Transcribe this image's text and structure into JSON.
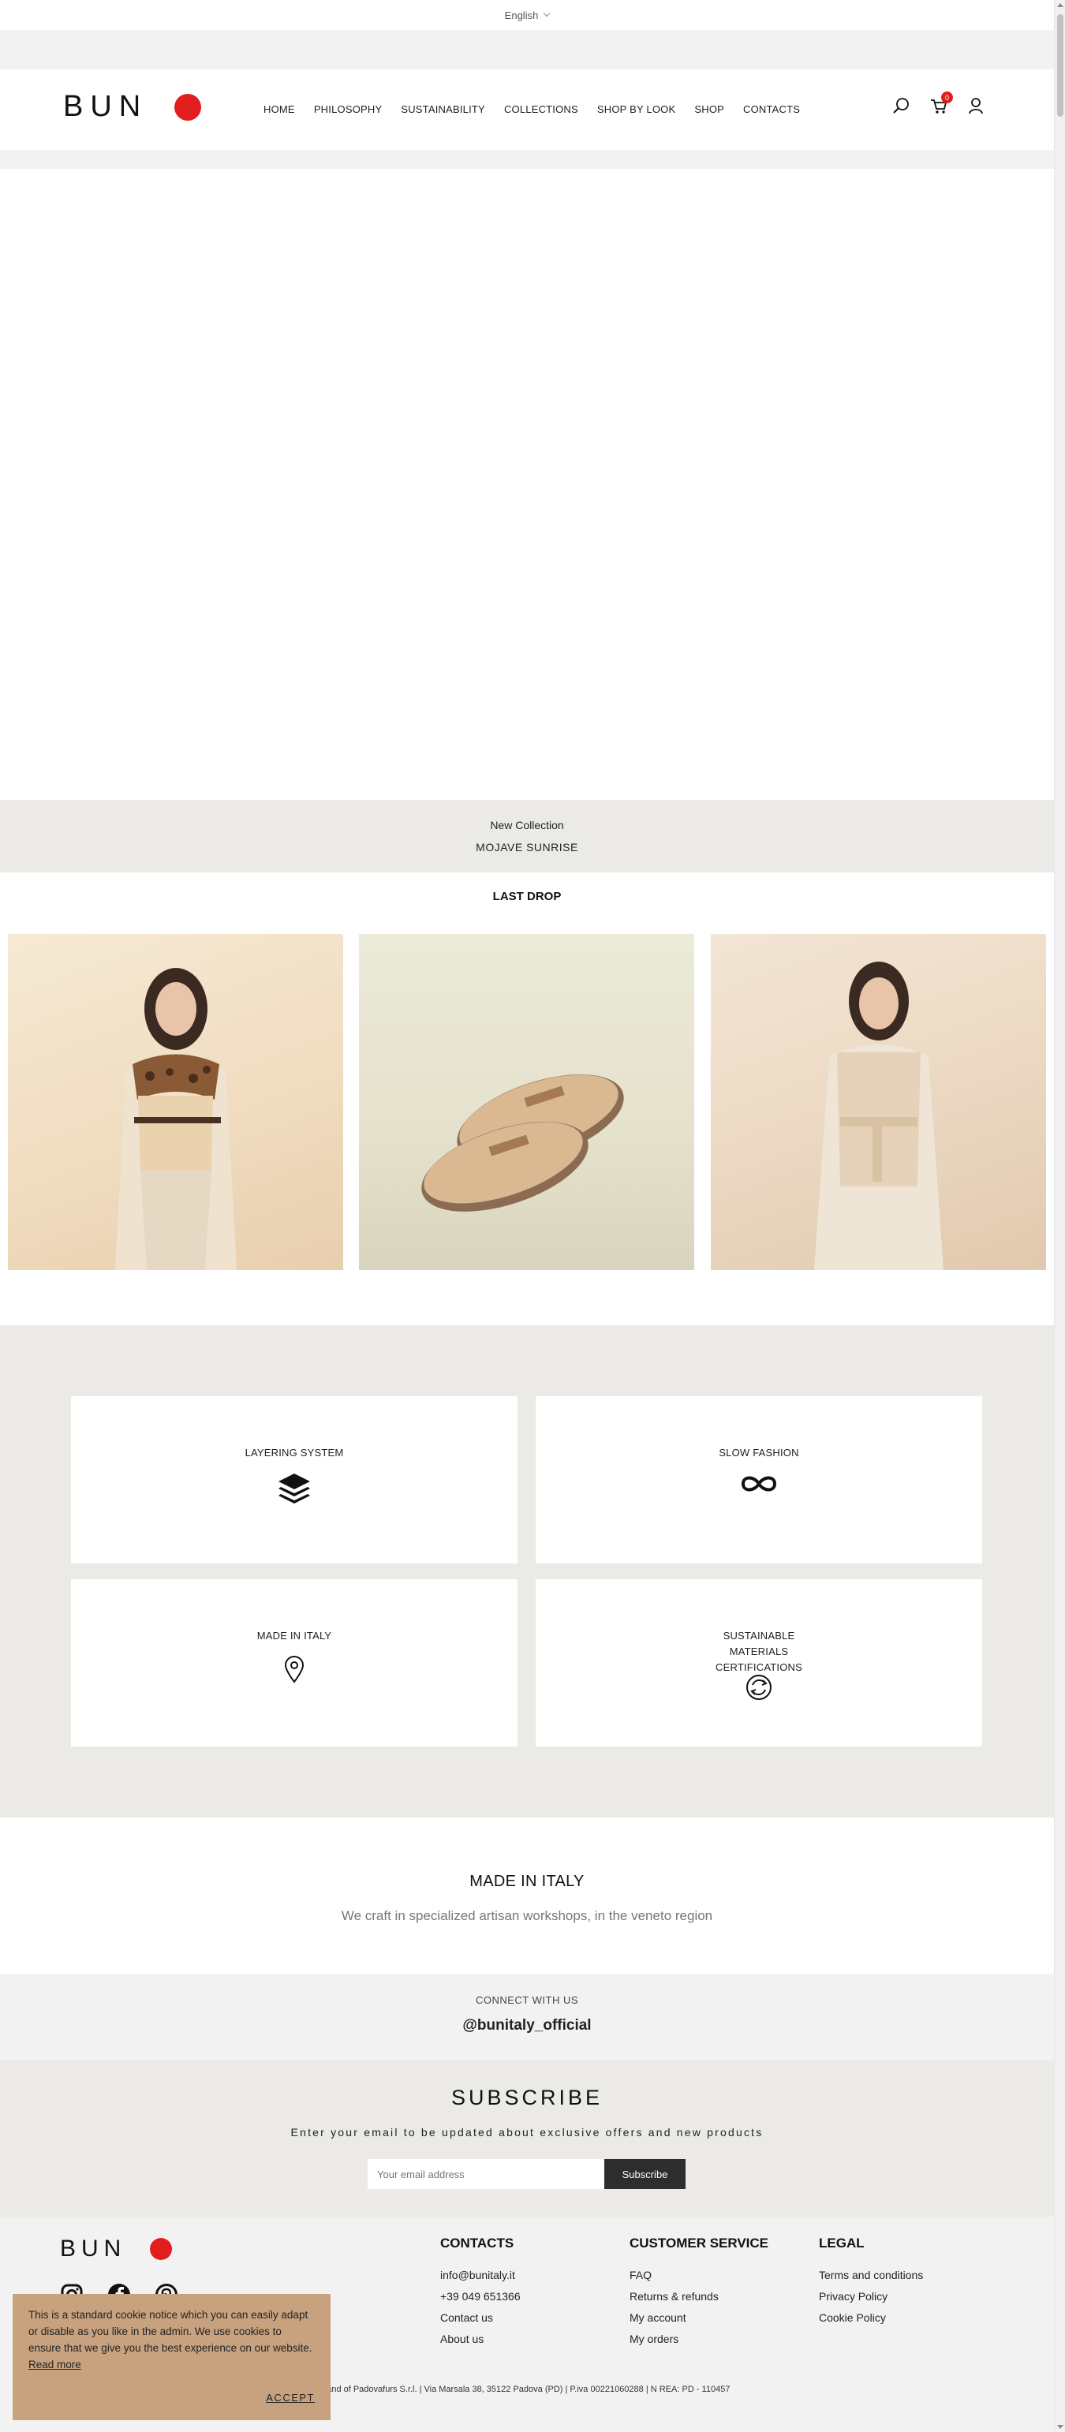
{
  "language": {
    "selected": "English"
  },
  "header": {
    "logo_text": "BUN",
    "nav": [
      "HOME",
      "PHILOSOPHY",
      "SUSTAINABILITY",
      "COLLECTIONS",
      "SHOP BY LOOK",
      "SHOP",
      "CONTACTS"
    ],
    "cart_count": "0"
  },
  "collection": {
    "subtitle": "New Collection",
    "name": "MOJAVE SUNRISE"
  },
  "last_drop": {
    "title": "LAST DROP"
  },
  "features": [
    {
      "title": "LAYERING SYSTEM",
      "icon": "layers-icon"
    },
    {
      "title": "SLOW FASHION",
      "icon": "infinity-icon"
    },
    {
      "title": "MADE IN ITALY",
      "icon": "map-pin-icon"
    },
    {
      "title": "SUSTAINABLE MATERIALS CERTIFICATIONS",
      "icon": "recycle-icon"
    }
  ],
  "made_in_italy": {
    "title": "MADE IN ITALY",
    "text": "We craft in specialized artisan workshops, in the veneto region"
  },
  "connect": {
    "label": "CONNECT WITH US",
    "handle": "@bunitaly_official"
  },
  "subscribe": {
    "title": "SUBSCRIBE",
    "description": "Enter your email to be updated about exclusive offers and new products",
    "placeholder": "Your email address",
    "button": "Subscribe"
  },
  "footer": {
    "logo_text": "BUN",
    "contacts": {
      "title": "CONTACTS",
      "links": [
        "info@bunitaly.it",
        "+39 049 651366",
        "Contact us",
        "About us"
      ]
    },
    "customer_service": {
      "title": "CUSTOMER SERVICE",
      "links": [
        "FAQ",
        "Returns & refunds",
        "My account",
        "My orders"
      ]
    },
    "legal": {
      "title": "LEGAL",
      "links": [
        "Terms and conditions",
        "Privacy Policy",
        "Cookie Policy"
      ]
    },
    "company": "rand of Padovafurs S.r.l. | Via Marsala 38, 35122 Padova (PD) | P.iva 00221060288 | N REA: PD - 110457"
  },
  "cookie": {
    "text": "This is a standard cookie notice which you can easily adapt or disable as you like in the admin. We use cookies to ensure that we give you the best experience on our website.",
    "read_more": "Read more",
    "accept": "ACCEPT"
  },
  "colors": {
    "brand_red": "#e21d1d",
    "cookie_bg": "#c8a27e",
    "section_beige": "#ebeae6",
    "button_dark": "#2d2d2d"
  }
}
